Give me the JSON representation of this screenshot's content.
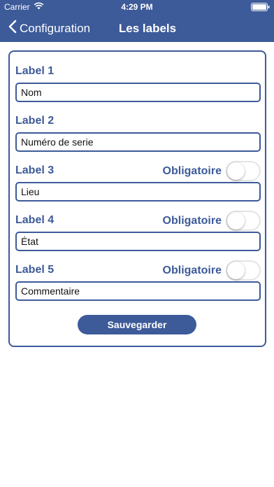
{
  "status_bar": {
    "carrier": "Carrier",
    "time": "4:29 PM"
  },
  "nav": {
    "back_label": "Configuration",
    "title": "Les labels"
  },
  "fields": [
    {
      "label": "Label 1",
      "value": "Nom"
    },
    {
      "label": "Label 2",
      "value": "Numéro de serie"
    },
    {
      "label": "Label 3",
      "value": "Lieu",
      "required_label": "Obligatoire",
      "required": false
    },
    {
      "label": "Label 4",
      "value": "État",
      "required_label": "Obligatoire",
      "required": false
    },
    {
      "label": "Label 5",
      "value": "Commentaire",
      "required_label": "Obligatoire",
      "required": false
    }
  ],
  "save_label": "Sauvegarder",
  "colors": {
    "accent": "#3d5a99",
    "background": "#ffffff",
    "toggle_off_border": "#e4e4e4"
  },
  "icons": {
    "wifi": "wifi-icon",
    "battery": "battery-icon",
    "back": "chevron-left-icon"
  }
}
